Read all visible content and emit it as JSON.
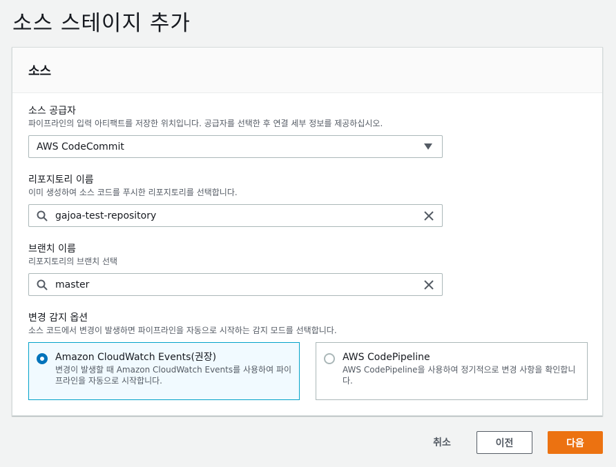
{
  "page": {
    "title": "소스 스테이지 추가"
  },
  "panel": {
    "title": "소스"
  },
  "source_provider": {
    "label": "소스 공급자",
    "description": "파이프라인의 입력 아티팩트를 저장한 위치입니다. 공급자를 선택한 후 연결 세부 정보를 제공하십시오.",
    "selected_value": "AWS CodeCommit"
  },
  "repository": {
    "label": "리포지토리 이름",
    "description": "이미 생성하여 소스 코드를 푸시한 리포지토리를 선택합니다.",
    "value": "gajoa-test-repository"
  },
  "branch": {
    "label": "브랜치 이름",
    "description": "리포지토리의 브랜치 선택",
    "value": "master"
  },
  "detection": {
    "label": "변경 감지 옵션",
    "description": "소스 코드에서 변경이 발생하면 파이프라인을 자동으로 시작하는 감지 모드를 선택합니다.",
    "options": [
      {
        "title": "Amazon CloudWatch Events(권장)",
        "description": "변경이 발생할 때 Amazon CloudWatch Events를 사용하여 파이프라인을 자동으로 시작합니다.",
        "selected": true
      },
      {
        "title": "AWS CodePipeline",
        "description": "AWS CodePipeline을 사용하여 정기적으로 변경 사항을 확인합니다.",
        "selected": false
      }
    ]
  },
  "footer": {
    "cancel_label": "취소",
    "previous_label": "이전",
    "next_label": "다음"
  },
  "colors": {
    "primary_button": "#ec7211",
    "selected_tile_border": "#00a1c9",
    "selected_tile_bg": "#f1faff",
    "radio_checked": "#0073bb"
  },
  "icons": {
    "dropdown": "caret-down-icon",
    "search": "search-icon",
    "clear": "close-icon"
  }
}
